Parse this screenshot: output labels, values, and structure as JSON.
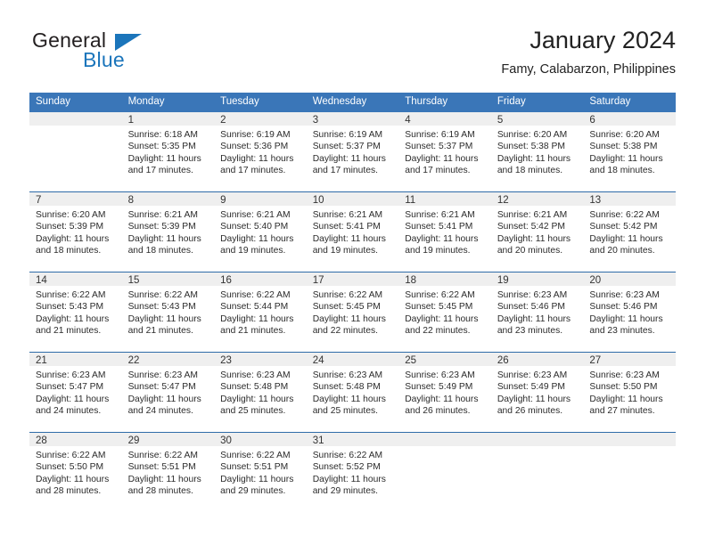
{
  "logo": {
    "word_one": "General",
    "word_two": "Blue",
    "triangle_color": "#1b75bb",
    "text_color": "#231f20",
    "blue_color": "#1b75bb"
  },
  "header": {
    "month_title": "January 2024",
    "location": "Famy, Calabarzon, Philippines",
    "header_bg": "#3a76b8",
    "row_divider": "#2e6ca8",
    "daynum_band_bg": "#efefef"
  },
  "weekdays": [
    "Sunday",
    "Monday",
    "Tuesday",
    "Wednesday",
    "Thursday",
    "Friday",
    "Saturday"
  ],
  "weeks": [
    [
      {
        "day": "",
        "sunrise": "",
        "sunset": "",
        "daylight": ""
      },
      {
        "day": "1",
        "sunrise": "Sunrise: 6:18 AM",
        "sunset": "Sunset: 5:35 PM",
        "daylight": "Daylight: 11 hours and 17 minutes."
      },
      {
        "day": "2",
        "sunrise": "Sunrise: 6:19 AM",
        "sunset": "Sunset: 5:36 PM",
        "daylight": "Daylight: 11 hours and 17 minutes."
      },
      {
        "day": "3",
        "sunrise": "Sunrise: 6:19 AM",
        "sunset": "Sunset: 5:37 PM",
        "daylight": "Daylight: 11 hours and 17 minutes."
      },
      {
        "day": "4",
        "sunrise": "Sunrise: 6:19 AM",
        "sunset": "Sunset: 5:37 PM",
        "daylight": "Daylight: 11 hours and 17 minutes."
      },
      {
        "day": "5",
        "sunrise": "Sunrise: 6:20 AM",
        "sunset": "Sunset: 5:38 PM",
        "daylight": "Daylight: 11 hours and 18 minutes."
      },
      {
        "day": "6",
        "sunrise": "Sunrise: 6:20 AM",
        "sunset": "Sunset: 5:38 PM",
        "daylight": "Daylight: 11 hours and 18 minutes."
      }
    ],
    [
      {
        "day": "7",
        "sunrise": "Sunrise: 6:20 AM",
        "sunset": "Sunset: 5:39 PM",
        "daylight": "Daylight: 11 hours and 18 minutes."
      },
      {
        "day": "8",
        "sunrise": "Sunrise: 6:21 AM",
        "sunset": "Sunset: 5:39 PM",
        "daylight": "Daylight: 11 hours and 18 minutes."
      },
      {
        "day": "9",
        "sunrise": "Sunrise: 6:21 AM",
        "sunset": "Sunset: 5:40 PM",
        "daylight": "Daylight: 11 hours and 19 minutes."
      },
      {
        "day": "10",
        "sunrise": "Sunrise: 6:21 AM",
        "sunset": "Sunset: 5:41 PM",
        "daylight": "Daylight: 11 hours and 19 minutes."
      },
      {
        "day": "11",
        "sunrise": "Sunrise: 6:21 AM",
        "sunset": "Sunset: 5:41 PM",
        "daylight": "Daylight: 11 hours and 19 minutes."
      },
      {
        "day": "12",
        "sunrise": "Sunrise: 6:21 AM",
        "sunset": "Sunset: 5:42 PM",
        "daylight": "Daylight: 11 hours and 20 minutes."
      },
      {
        "day": "13",
        "sunrise": "Sunrise: 6:22 AM",
        "sunset": "Sunset: 5:42 PM",
        "daylight": "Daylight: 11 hours and 20 minutes."
      }
    ],
    [
      {
        "day": "14",
        "sunrise": "Sunrise: 6:22 AM",
        "sunset": "Sunset: 5:43 PM",
        "daylight": "Daylight: 11 hours and 21 minutes."
      },
      {
        "day": "15",
        "sunrise": "Sunrise: 6:22 AM",
        "sunset": "Sunset: 5:43 PM",
        "daylight": "Daylight: 11 hours and 21 minutes."
      },
      {
        "day": "16",
        "sunrise": "Sunrise: 6:22 AM",
        "sunset": "Sunset: 5:44 PM",
        "daylight": "Daylight: 11 hours and 21 minutes."
      },
      {
        "day": "17",
        "sunrise": "Sunrise: 6:22 AM",
        "sunset": "Sunset: 5:45 PM",
        "daylight": "Daylight: 11 hours and 22 minutes."
      },
      {
        "day": "18",
        "sunrise": "Sunrise: 6:22 AM",
        "sunset": "Sunset: 5:45 PM",
        "daylight": "Daylight: 11 hours and 22 minutes."
      },
      {
        "day": "19",
        "sunrise": "Sunrise: 6:23 AM",
        "sunset": "Sunset: 5:46 PM",
        "daylight": "Daylight: 11 hours and 23 minutes."
      },
      {
        "day": "20",
        "sunrise": "Sunrise: 6:23 AM",
        "sunset": "Sunset: 5:46 PM",
        "daylight": "Daylight: 11 hours and 23 minutes."
      }
    ],
    [
      {
        "day": "21",
        "sunrise": "Sunrise: 6:23 AM",
        "sunset": "Sunset: 5:47 PM",
        "daylight": "Daylight: 11 hours and 24 minutes."
      },
      {
        "day": "22",
        "sunrise": "Sunrise: 6:23 AM",
        "sunset": "Sunset: 5:47 PM",
        "daylight": "Daylight: 11 hours and 24 minutes."
      },
      {
        "day": "23",
        "sunrise": "Sunrise: 6:23 AM",
        "sunset": "Sunset: 5:48 PM",
        "daylight": "Daylight: 11 hours and 25 minutes."
      },
      {
        "day": "24",
        "sunrise": "Sunrise: 6:23 AM",
        "sunset": "Sunset: 5:48 PM",
        "daylight": "Daylight: 11 hours and 25 minutes."
      },
      {
        "day": "25",
        "sunrise": "Sunrise: 6:23 AM",
        "sunset": "Sunset: 5:49 PM",
        "daylight": "Daylight: 11 hours and 26 minutes."
      },
      {
        "day": "26",
        "sunrise": "Sunrise: 6:23 AM",
        "sunset": "Sunset: 5:49 PM",
        "daylight": "Daylight: 11 hours and 26 minutes."
      },
      {
        "day": "27",
        "sunrise": "Sunrise: 6:23 AM",
        "sunset": "Sunset: 5:50 PM",
        "daylight": "Daylight: 11 hours and 27 minutes."
      }
    ],
    [
      {
        "day": "28",
        "sunrise": "Sunrise: 6:22 AM",
        "sunset": "Sunset: 5:50 PM",
        "daylight": "Daylight: 11 hours and 28 minutes."
      },
      {
        "day": "29",
        "sunrise": "Sunrise: 6:22 AM",
        "sunset": "Sunset: 5:51 PM",
        "daylight": "Daylight: 11 hours and 28 minutes."
      },
      {
        "day": "30",
        "sunrise": "Sunrise: 6:22 AM",
        "sunset": "Sunset: 5:51 PM",
        "daylight": "Daylight: 11 hours and 29 minutes."
      },
      {
        "day": "31",
        "sunrise": "Sunrise: 6:22 AM",
        "sunset": "Sunset: 5:52 PM",
        "daylight": "Daylight: 11 hours and 29 minutes."
      },
      {
        "day": "",
        "sunrise": "",
        "sunset": "",
        "daylight": ""
      },
      {
        "day": "",
        "sunrise": "",
        "sunset": "",
        "daylight": ""
      },
      {
        "day": "",
        "sunrise": "",
        "sunset": "",
        "daylight": ""
      }
    ]
  ]
}
